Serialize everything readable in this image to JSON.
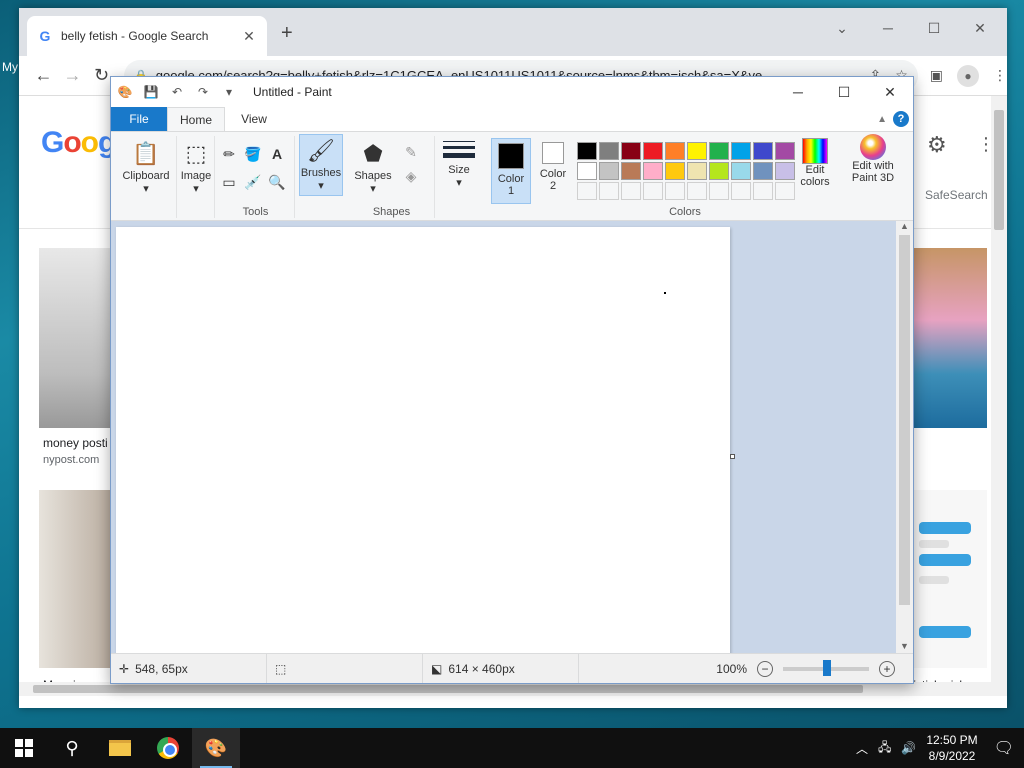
{
  "desktop": {
    "label": "My"
  },
  "chrome": {
    "tab_title": "belly fetish - Google Search",
    "tab_close": "✕",
    "new_tab": "+",
    "url": "google.com/search?q=belly+fetish&rlz=1C1GCEA_enUS1011US1011&source=lnms&tbm=isch&sa=X&ve...",
    "controls": {
      "minimize": "─",
      "maximize": "☐",
      "close": "✕"
    },
    "nav": {
      "back": "←",
      "forward": "→",
      "reload": "↻"
    },
    "page": {
      "logo": "Goog",
      "safesearch": "SafeSearch",
      "results": [
        {
          "caption": "money posti",
          "source": "nypost.com"
        },
        {
          "caption": "Mum issues",
          "source": ""
        },
        {
          "caption": "fetish pick...",
          "source": ""
        }
      ]
    }
  },
  "paint": {
    "title": "Untitled - Paint",
    "tabs": {
      "file": "File",
      "home": "Home",
      "view": "View"
    },
    "ribbon": {
      "clipboard": "Clipboard",
      "image": "Image",
      "tools_group": "Tools",
      "brushes": "Brushes",
      "shapes": "Shapes",
      "shapes_group": "Shapes",
      "size": "Size",
      "color1": "Color\n1",
      "color1_line1": "Color",
      "color1_line2": "1",
      "color2_line1": "Color",
      "color2_line2": "2",
      "colors_group": "Colors",
      "edit_colors_line1": "Edit",
      "edit_colors_line2": "colors",
      "paint3d_line1": "Edit with",
      "paint3d_line2": "Paint 3D",
      "help": "?"
    },
    "palette": [
      "#000000",
      "#7f7f7f",
      "#880015",
      "#ed1c24",
      "#ff7f27",
      "#fff200",
      "#22b14c",
      "#00a2e8",
      "#3f48cc",
      "#a349a4",
      "#ffffff",
      "#c3c3c3",
      "#b97a57",
      "#ffaec9",
      "#ffc90e",
      "#efe4b0",
      "#b5e61d",
      "#99d9ea",
      "#7092be",
      "#c8bfe7"
    ],
    "color1_value": "#000000",
    "color2_value": "#ffffff",
    "status": {
      "cursor": "548, 65px",
      "canvas_size": "614 × 460px",
      "zoom": "100%",
      "zoom_out": "−",
      "zoom_in": "+"
    }
  },
  "taskbar": {
    "time": "12:50 PM",
    "date": "8/9/2022"
  }
}
